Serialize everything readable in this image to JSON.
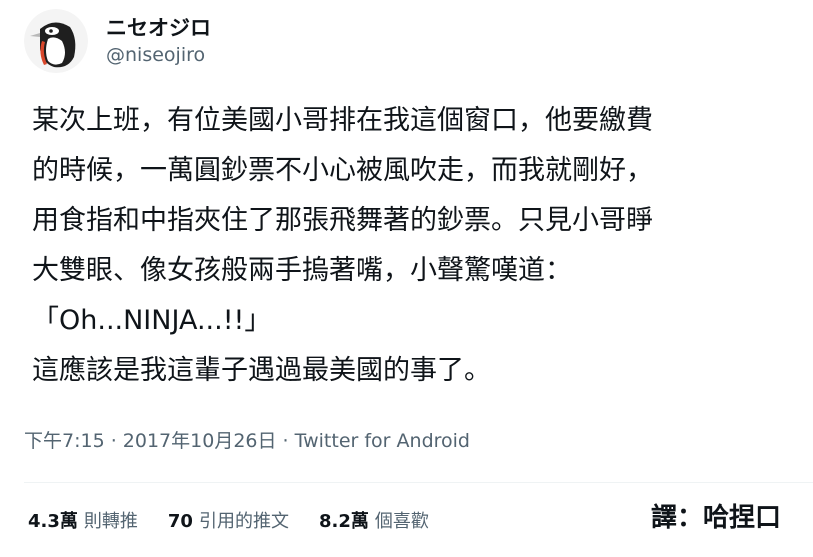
{
  "author": {
    "display_name": "ニセオジロ",
    "handle": "@niseojiro",
    "avatar_icon": "penguin-avatar-icon"
  },
  "tweet": {
    "lines": [
      "某次上班，有位美國小哥排在我這個窗口，他要繳費",
      "的時候，一萬圓鈔票不小心被風吹走，而我就剛好，",
      "用食指和中指夾住了那張飛舞著的鈔票。只見小哥睜",
      "大雙眼、像女孩般兩手摀著嘴，小聲驚嘆道：",
      "「Oh...NINJA...!!」",
      "這應該是我這輩子遇過最美國的事了。"
    ]
  },
  "meta": {
    "time": "下午7:15",
    "separator": " · ",
    "date": "2017年10月26日",
    "source": "Twitter for Android"
  },
  "stats": {
    "retweets_count": "4.3萬",
    "retweets_label": "則轉推",
    "quotes_count": "70",
    "quotes_label": "引用的推文",
    "likes_count": "8.2萬",
    "likes_label": "個喜歡"
  },
  "translator_credit": "譯：哈捏口",
  "colors": {
    "text_primary": "#0f1419",
    "text_secondary": "#536471",
    "divider": "#eff3f4"
  }
}
